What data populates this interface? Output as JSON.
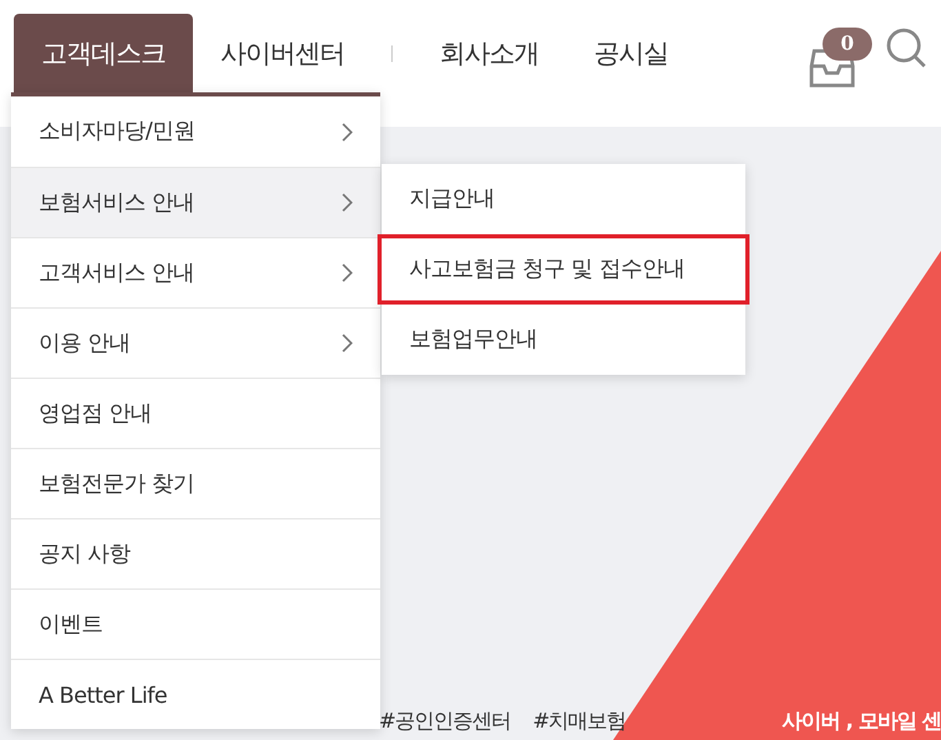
{
  "nav": {
    "items": [
      {
        "label": "고객데스크",
        "selected": true
      },
      {
        "label": "사이버센터",
        "selected": false
      },
      {
        "label": "회사소개",
        "selected": false
      },
      {
        "label": "공시실",
        "selected": false
      }
    ],
    "cart_count": "0"
  },
  "menu": {
    "items": [
      {
        "label": "소비자마당/민원",
        "has_submenu": true,
        "selected": false
      },
      {
        "label": "보험서비스 안내",
        "has_submenu": true,
        "selected": true
      },
      {
        "label": "고객서비스 안내",
        "has_submenu": true,
        "selected": false
      },
      {
        "label": "이용 안내",
        "has_submenu": true,
        "selected": false
      },
      {
        "label": "영업점 안내",
        "has_submenu": false,
        "selected": false
      },
      {
        "label": "보험전문가 찾기",
        "has_submenu": false,
        "selected": false
      },
      {
        "label": "공지 사항",
        "has_submenu": false,
        "selected": false
      },
      {
        "label": "이벤트",
        "has_submenu": false,
        "selected": false
      },
      {
        "label": "A Better Life",
        "has_submenu": false,
        "selected": false
      }
    ]
  },
  "submenu": {
    "items": [
      {
        "label": "지급안내",
        "highlighted": false
      },
      {
        "label": "사고보험금 청구 및 접수안내",
        "highlighted": true
      },
      {
        "label": "보험업무안내",
        "highlighted": false
      }
    ]
  },
  "hashtags": [
    "#공인인증센터",
    "#치매보험"
  ],
  "banner": {
    "caption": "사이버 , 모바일 센"
  }
}
